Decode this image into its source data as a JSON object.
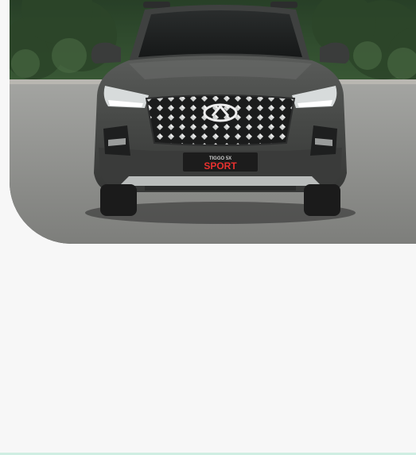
{
  "hero": {
    "badge_model": "TIGGO 5X",
    "badge_trim": "SPORT"
  },
  "icons": {
    "brand_logo": "chery-emblem-icon"
  },
  "colors": {
    "page_background": "#f7f7f7",
    "car_body": "#4a4c4a",
    "sport_badge": "#e8312f",
    "foliage": "#2e4a2c",
    "asphalt": "#8e8f8c",
    "bottom_accent": "#cfeee2"
  }
}
